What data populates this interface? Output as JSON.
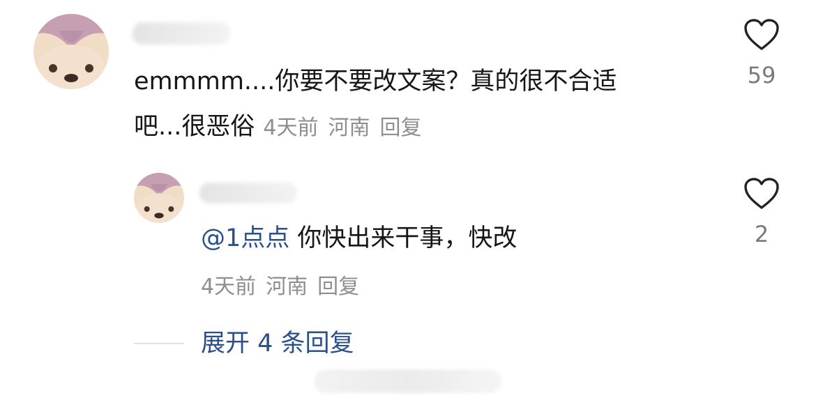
{
  "comment": {
    "text_line1": "emmmm....你要不要改文案？真的很不合适",
    "text_line2": "吧...很恶俗",
    "time": "4天前",
    "location": "河南",
    "reply_label": "回复",
    "like_count": "59"
  },
  "reply": {
    "mention": "@1点点",
    "text": " 你快出来干事，快改",
    "time": "4天前",
    "location": "河南",
    "reply_label": "回复",
    "like_count": "2"
  },
  "expand_label": "展开 4 条回复",
  "icons": {
    "like": "heart-outline-icon"
  }
}
